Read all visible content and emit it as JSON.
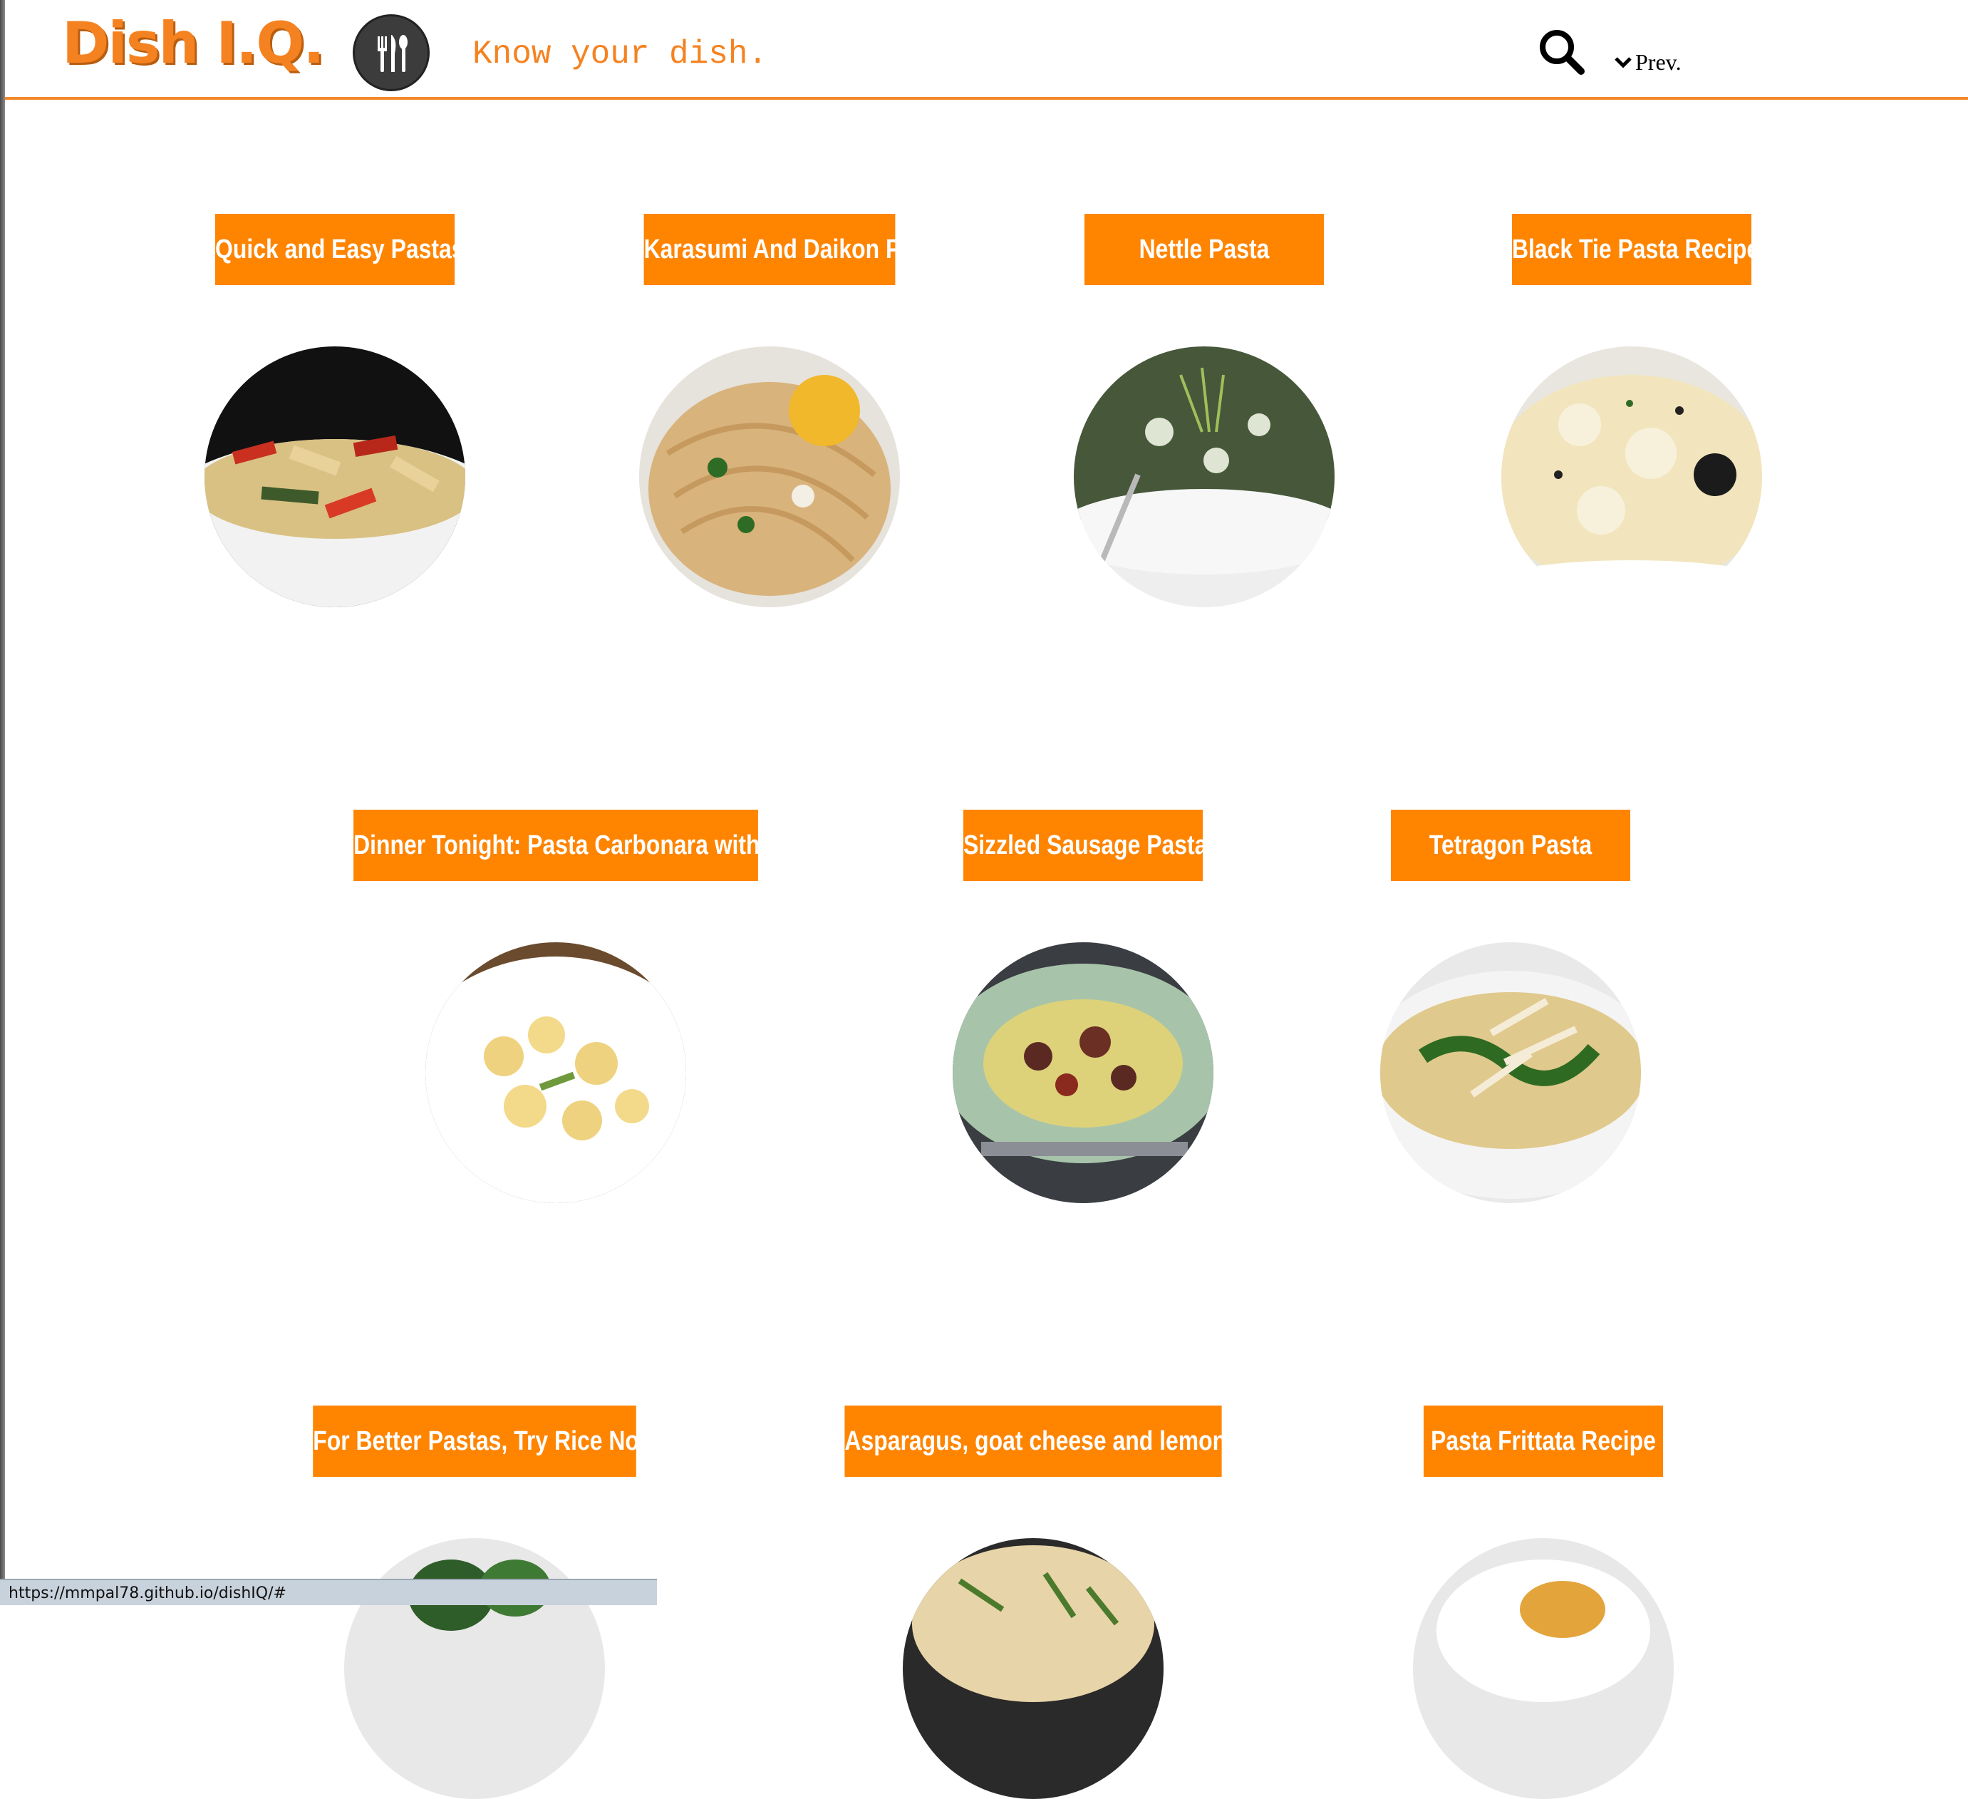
{
  "header": {
    "logo_text": "Dish I.Q.",
    "logo_icon": "fork-knife-spoon-icon",
    "tagline": "Know your dish.",
    "search_icon": "search-icon",
    "prev_label": "Prev.",
    "prev_icon": "chevron-down-icon",
    "accent_color": "#f58220"
  },
  "recipes": [
    {
      "title": "Quick and Easy Pastas",
      "image": "pasta-photo-red-peppers"
    },
    {
      "title": "Karasumi And Daikon Pasta",
      "image": "pasta-photo-spaghetti"
    },
    {
      "title": "Nettle Pasta",
      "image": "pasta-photo-greens"
    },
    {
      "title": "Black Tie Pasta Recipe",
      "image": "pasta-photo-cream"
    },
    {
      "title": "Dinner Tonight: Pasta Carbonara with Leeks",
      "image": "pasta-photo-shells"
    },
    {
      "title": "Sizzled Sausage Pasta",
      "image": "pasta-photo-sausage"
    },
    {
      "title": "Tetragon Pasta",
      "image": "pasta-photo-fusilli"
    },
    {
      "title": "For Better Pastas, Try Rice Noodles",
      "image": "pasta-photo-noodles"
    },
    {
      "title": "Asparagus, goat cheese and lemon pasta",
      "image": "pasta-photo-asparagus"
    },
    {
      "title": "Pasta Frittata Recipe",
      "image": "pasta-photo-frittata"
    }
  ],
  "status_bar": {
    "url": "https://mmpal78.github.io/dishIQ/#"
  }
}
